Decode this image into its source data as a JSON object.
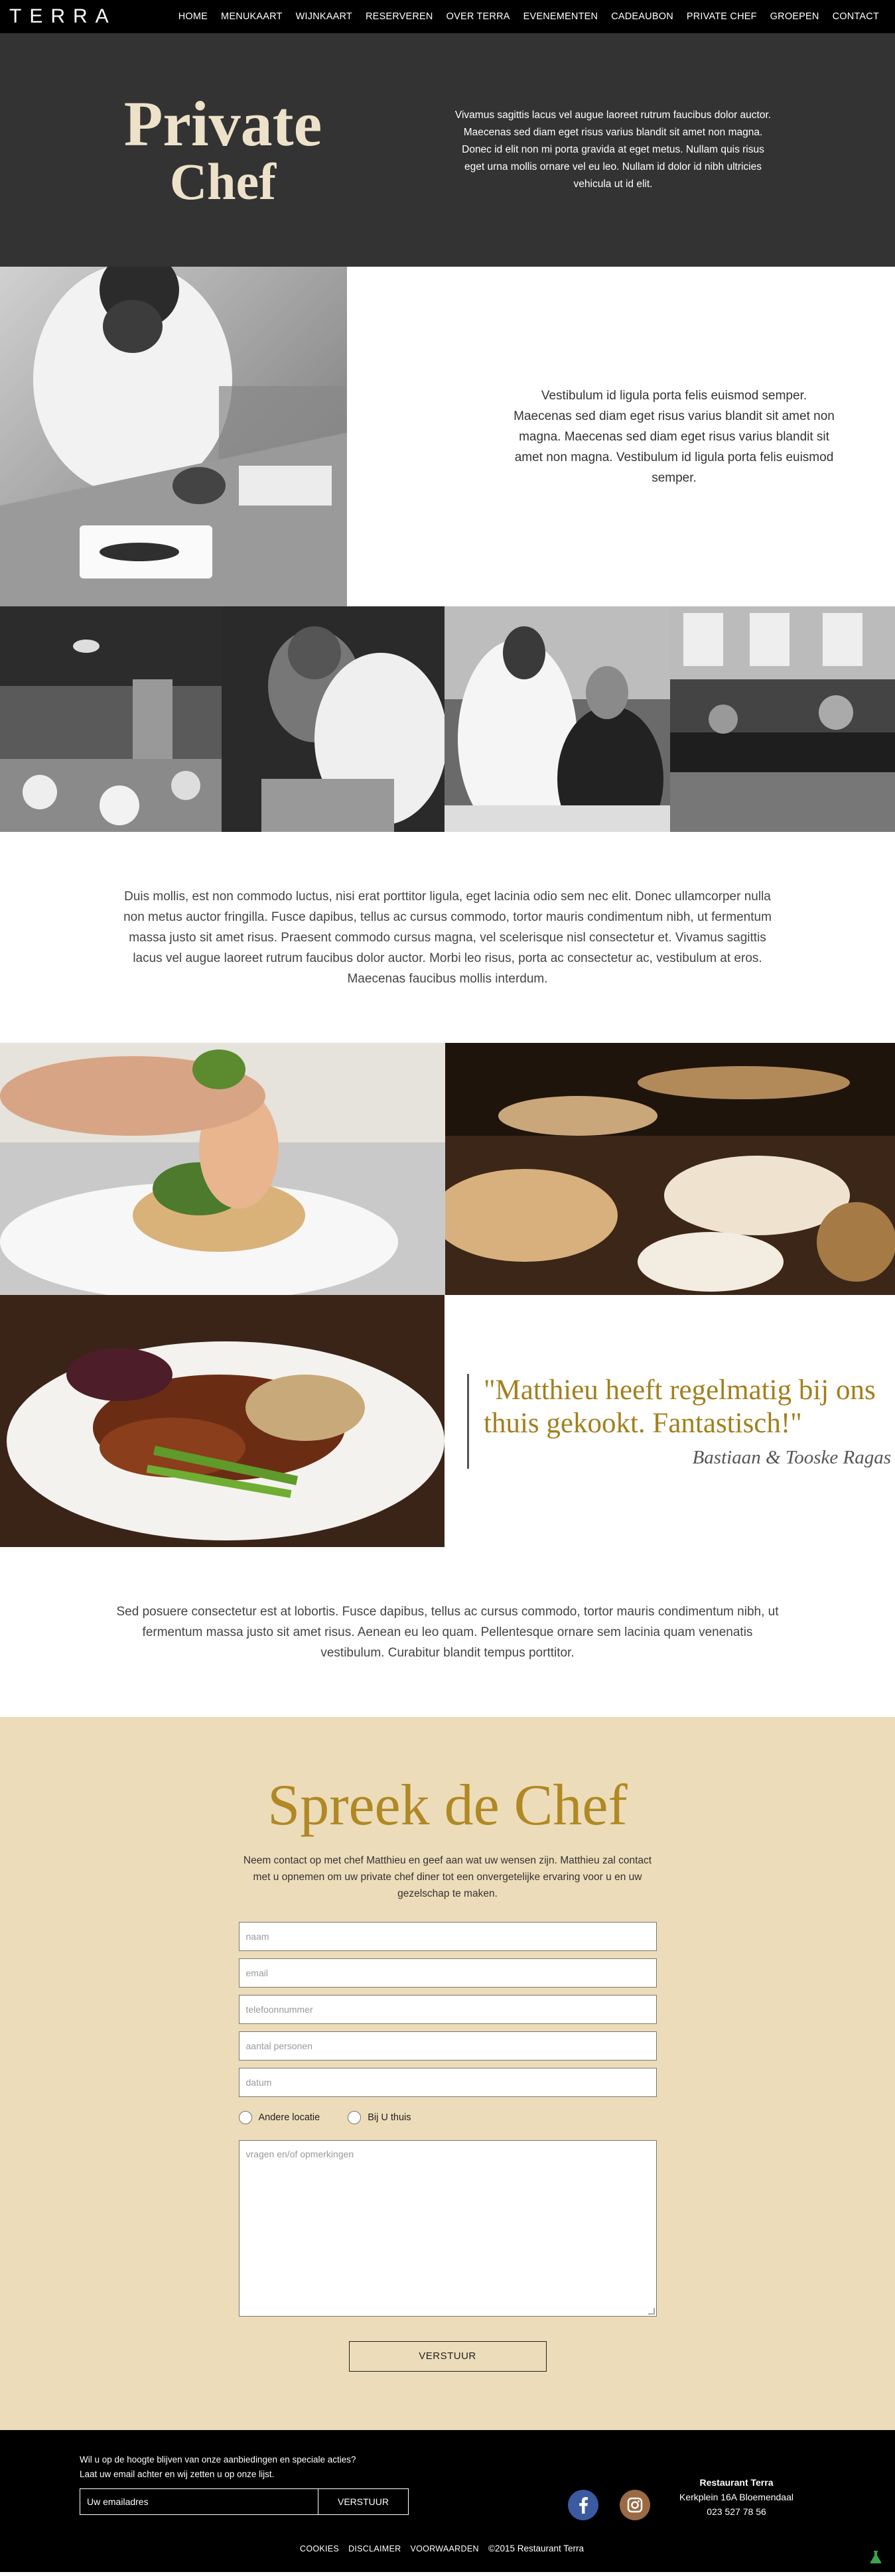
{
  "header": {
    "logo": "TERRA",
    "nav": [
      "HOME",
      "MENUKAART",
      "WIJNKAART",
      "RESERVEREN",
      "OVER TERRA",
      "EVENEMENTEN",
      "CADEAUBON",
      "PRIVATE CHEF",
      "GROEPEN",
      "CONTACT"
    ]
  },
  "hero": {
    "title_line1": "Private",
    "title_line2": "Chef",
    "text": "Vivamus sagittis lacus vel augue laoreet rutrum faucibus dolor auctor. Maecenas sed diam eget risus varius blandit sit amet non magna. Donec id elit non mi porta gravida at eget metus. Nullam quis risus eget urna mollis ornare vel eu leo. Nullam id dolor id nibh ultricies vehicula ut id elit."
  },
  "intro": {
    "text": "Vestibulum id ligula porta felis euismod semper. Maecenas sed diam eget risus varius blandit sit amet non magna. Maecenas sed diam eget risus varius blandit sit amet non magna. Vestibulum id ligula porta felis euismod semper."
  },
  "body1": {
    "text": "Duis mollis, est non commodo luctus, nisi erat porttitor ligula, eget lacinia odio sem nec elit. Donec ullamcorper nulla non metus auctor fringilla. Fusce dapibus, tellus ac cursus commodo, tortor mauris condimentum nibh, ut fermentum massa justo sit amet risus. Praesent commodo cursus magna, vel scelerisque nisl consectetur et. Vivamus sagittis lacus vel augue laoreet rutrum faucibus dolor auctor. Morbi leo risus, porta ac consectetur ac, vestibulum at eros. Maecenas faucibus mollis interdum."
  },
  "quote": {
    "text": "\"Matthieu heeft regelmatig bij ons thuis gekookt. Fantastisch!\"",
    "author": "Bastiaan & Tooske Ragas"
  },
  "body2": {
    "text": "Sed posuere consectetur est at lobortis. Fusce dapibus, tellus ac cursus commodo, tortor mauris condimentum nibh, ut fermentum massa justo sit amet risus. Aenean eu leo quam. Pellentesque ornare sem lacinia quam venenatis vestibulum. Curabitur blandit tempus porttitor."
  },
  "contact": {
    "title": "Spreek de Chef",
    "intro": "Neem contact op met chef Matthieu en geef aan wat uw wensen zijn. Matthieu zal contact met u opnemen om uw private chef diner tot een onvergetelijke ervaring voor u en uw gezelschap te maken.",
    "fields": {
      "naam": "naam",
      "email": "email",
      "telefoon": "telefoonnummer",
      "personen": "aantal personen",
      "datum": "datum"
    },
    "radio_andere": "Andere locatie",
    "radio_thuis": "Bij U thuis",
    "textarea_placeholder": "vragen en/of opmerkingen",
    "submit": "VERSTUUR"
  },
  "footer": {
    "newsletter_line1": "Wil u op de hoogte blijven van onze aanbiedingen en speciale acties?",
    "newsletter_line2": "Laat uw email achter en wij zetten u op onze lijst.",
    "newsletter_placeholder": "Uw emailadres",
    "newsletter_button": "VERSTUUR",
    "address_name": "Restaurant Terra",
    "address_street": "Kerkplein 16A Bloemendaal",
    "address_phone": "023 527 78 56",
    "links": [
      "COOKIES",
      "DISCLAIMER",
      "VOORWAARDEN"
    ],
    "copyright": "©2015 Restaurant Terra"
  },
  "icons": {
    "facebook": "facebook-icon",
    "instagram": "instagram-icon"
  },
  "colors": {
    "hero_bg": "#333333",
    "gold": "#b08824",
    "quote_gold": "#a37f1c",
    "contact_bg": "#ecdcb9",
    "facebook_blue": "#3b5aa0"
  }
}
